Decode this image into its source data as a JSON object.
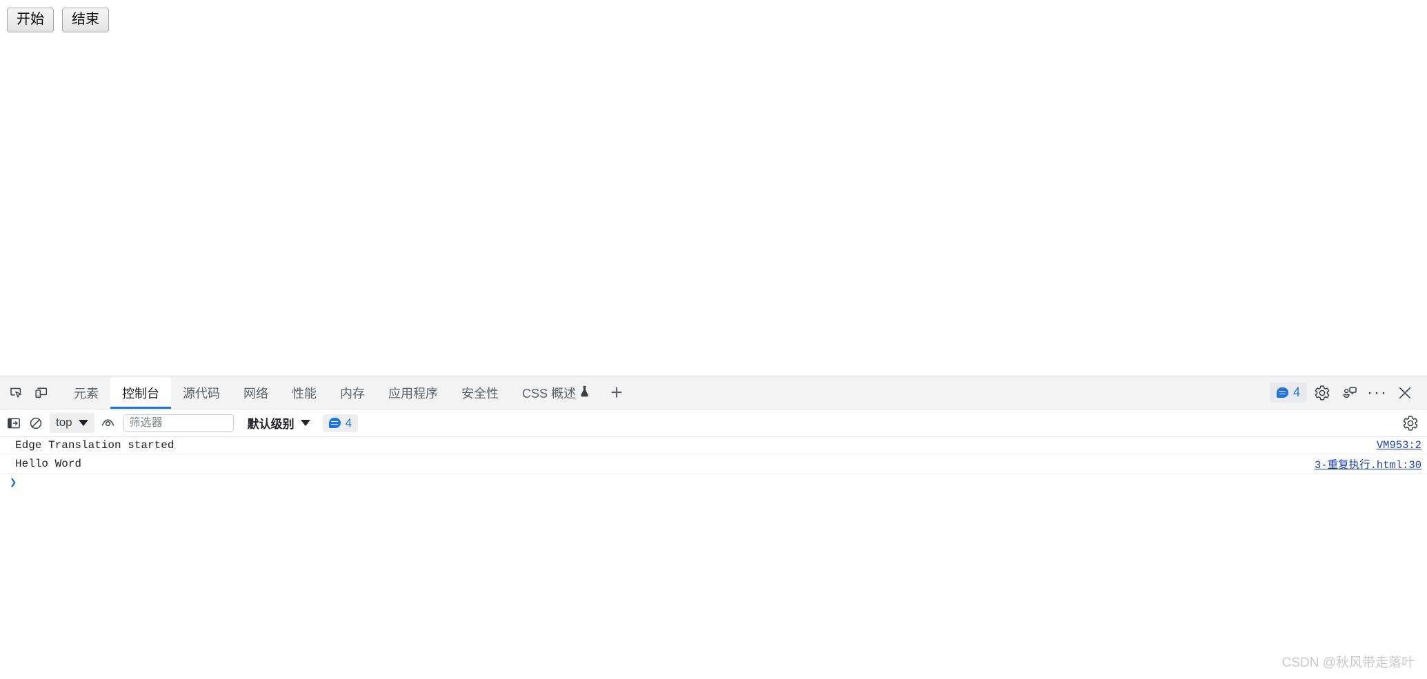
{
  "page": {
    "buttons": [
      {
        "label": "开始",
        "name": "start-button"
      },
      {
        "label": "结束",
        "name": "end-button"
      }
    ]
  },
  "devtools": {
    "left_icons": [
      {
        "name": "inspect-element-icon",
        "title": "检查元素"
      },
      {
        "name": "device-toolbar-icon",
        "title": "切换设备工具栏"
      }
    ],
    "tabs": [
      {
        "label": "元素",
        "active": false
      },
      {
        "label": "控制台",
        "active": true
      },
      {
        "label": "源代码",
        "active": false
      },
      {
        "label": "网络",
        "active": false
      },
      {
        "label": "性能",
        "active": false
      },
      {
        "label": "内存",
        "active": false
      },
      {
        "label": "应用程序",
        "active": false
      },
      {
        "label": "安全性",
        "active": false
      },
      {
        "label": "CSS 概述",
        "active": false,
        "icon": "flask-icon"
      }
    ],
    "add_tab_label": "+",
    "right": {
      "message_count": "4",
      "message_icon": "speech-bubble-icon",
      "settings_icon": "gear-icon",
      "feedback_icon": "feedback-icon",
      "more_label": "···",
      "close_label": "✕"
    }
  },
  "console_toolbar": {
    "sidebar_toggle_icon": "console-sidebar-icon",
    "clear_icon": "clear-console-icon",
    "context_value": "top",
    "eye_icon": "live-expression-eye-icon",
    "filter_placeholder": "筛选器",
    "filter_value": "",
    "level_label": "默认级别",
    "badge_count": "4",
    "settings_icon": "gear-icon"
  },
  "console_log": {
    "rows": [
      {
        "text": "Edge Translation started",
        "source": "VM953:2"
      },
      {
        "text": "Hello Word",
        "source": "3-重复执行.html:30"
      }
    ],
    "prompt_chevron": "❯",
    "prompt_value": ""
  },
  "watermark": {
    "text": "CSDN @秋风带走落叶"
  },
  "colors": {
    "accent_blue": "#1a73e8",
    "link_blue": "#1a3fb0",
    "tab_bar_bg": "#f3f3f3",
    "text_primary": "#202124",
    "text_muted": "#5f6368"
  }
}
